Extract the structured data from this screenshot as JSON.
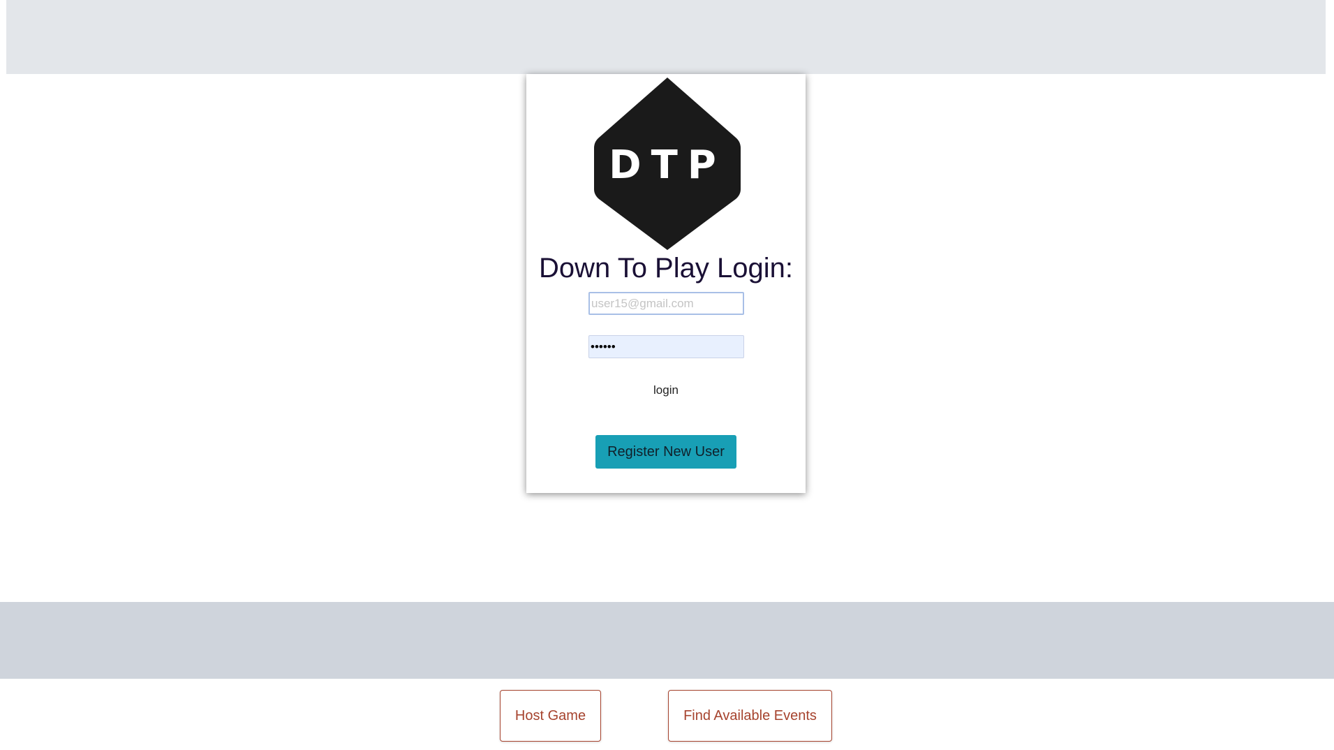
{
  "logo": {
    "text": "DTP",
    "color": "#1a1a1a"
  },
  "login_card": {
    "title": "Down To Play Login:",
    "email_placeholder": "user15@gmail.com",
    "email_value": "",
    "password_value": "passwd",
    "login_label": "login",
    "register_label": "Register New User",
    "register_color": "#189fb5"
  },
  "nav": {
    "host_game_label": "Host Game",
    "find_events_label": "Find Available Events",
    "button_color": "#a6432e"
  }
}
